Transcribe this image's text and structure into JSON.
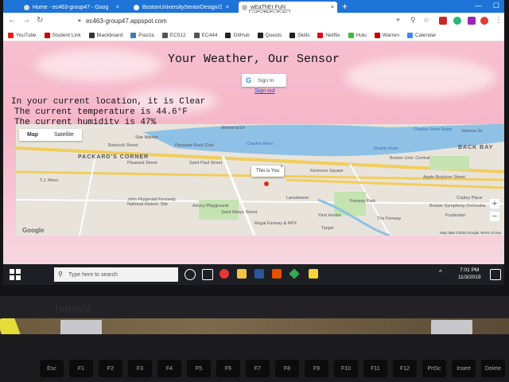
{
  "browser": {
    "tabs": [
      {
        "label": "Home - ec463-group47 - Goog",
        "close": "×"
      },
      {
        "label": "BostonUniversitySeniorDesign/2",
        "close": "×"
      },
      {
        "label": "wEaThEr FuN",
        "close": "×"
      }
    ],
    "tooltip": "wEaThEr FuN",
    "new_tab": "+",
    "url": "ec463-group47.appspot.com",
    "bookmarks": [
      {
        "label": "YouTube",
        "color": "#e62117"
      },
      {
        "label": "Student Link",
        "color": "#cc0000"
      },
      {
        "label": "Blackboard",
        "color": "#333333"
      },
      {
        "label": "Piazza",
        "color": "#3b7bbf"
      },
      {
        "label": "EC512",
        "color": "#555555"
      },
      {
        "label": "EC444",
        "color": "#555555"
      },
      {
        "label": "GitHub",
        "color": "#222222"
      },
      {
        "label": "Quests",
        "color": "#222222"
      },
      {
        "label": "Skills",
        "color": "#222222"
      },
      {
        "label": "Netflix",
        "color": "#e50914"
      },
      {
        "label": "Hulu",
        "color": "#3dbb3d"
      },
      {
        "label": "Warren",
        "color": "#cc0000"
      },
      {
        "label": "Calendar",
        "color": "#4285f4"
      }
    ]
  },
  "page": {
    "title": "Your Weather, Our Sensor",
    "signin_label": "Sign In",
    "signout_label": "Sign out",
    "status_lines": [
      "In your current location, it is Clear",
      "The current temperature is 44.6°F",
      "The current humidity is 47%"
    ]
  },
  "map": {
    "tab_map": "Map",
    "tab_satellite": "Satellite",
    "info_window": "This is You",
    "info_close": "×",
    "zoom_in": "+",
    "zoom_out": "−",
    "logo": "Google",
    "attribution": "Map data ©2019 Google   Terms of Use",
    "labels": [
      "Memorial Dr",
      "Charles River Basin",
      "Storrow Dr",
      "Charles River",
      "Star Market",
      "Paradise Rock Club",
      "Babcock Street",
      "PACKARD'S CORNER",
      "Pleasant Street",
      "Saint Paul Street",
      "BACK BAY",
      "Boston Univ. Central",
      "T.J. Maxx",
      "Kenmore Square",
      "Muddy River",
      "Apple Boylston Street",
      "Fenway Park",
      "Target",
      "Lansdowne",
      "Yard House",
      "Amory Playground",
      "John Fitzgerald Kennedy National Historic Site",
      "Saint Marys Street",
      "Regal Fenway & RPX",
      "The Fenway",
      "Prudential",
      "Copley Place",
      "Boston Symphony Orchestra"
    ]
  },
  "taskbar": {
    "search_placeholder": "Type here to search",
    "time": "7:01 PM",
    "date": "11/3/2019"
  },
  "keyboard": {
    "brand": "lenovo",
    "keys": [
      "Esc",
      "F1",
      "F2",
      "F3",
      "F4",
      "F5",
      "F6",
      "F7",
      "F8",
      "F9",
      "F10",
      "F11",
      "F12",
      "PrtSc",
      "Insert",
      "Delete"
    ]
  },
  "colors": {
    "tabbar": "#1e73d6",
    "page_pink": "#f5b6c8",
    "taskbar": "#1d1f24",
    "link": "#1a4fd6"
  }
}
